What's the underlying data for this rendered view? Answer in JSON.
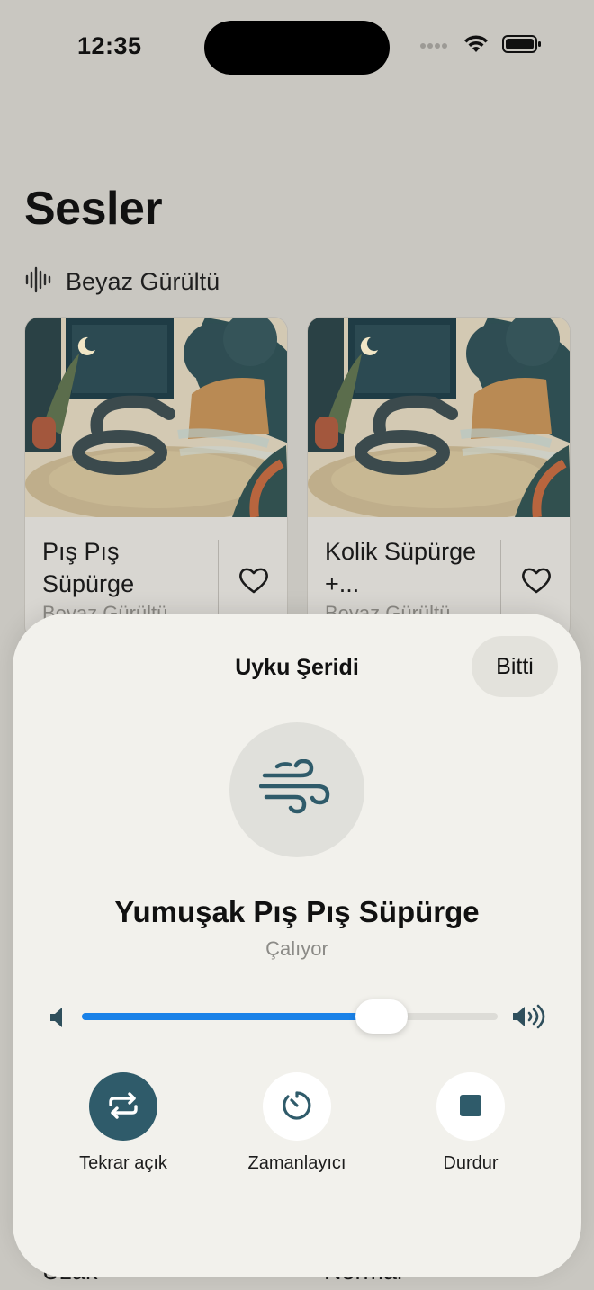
{
  "status_bar": {
    "time": "12:35"
  },
  "page": {
    "title": "Sesler"
  },
  "section": {
    "label": "Beyaz Gürültü",
    "icon": "waveform-icon"
  },
  "cards": [
    {
      "title": "Pış Pış Süpürge",
      "subtitle": "Beyaz Gürültü",
      "favorite_icon": "heart-icon"
    },
    {
      "title": "Kolik Süpürge +...",
      "subtitle": "Beyaz Gürültü",
      "favorite_icon": "heart-icon"
    }
  ],
  "bottom_cards": [
    {
      "title": "Uzak"
    },
    {
      "title": "Normal"
    }
  ],
  "sheet": {
    "title": "Uyku Şeridi",
    "done_label": "Bitti",
    "sound_icon": "wind-icon",
    "track_name": "Yumuşak Pış Pış Süpürge",
    "status": "Çalıyor",
    "volume": 0.72,
    "controls": [
      {
        "label": "Tekrar açık",
        "icon": "repeat-icon",
        "active": true
      },
      {
        "label": "Zamanlayıcı",
        "icon": "timer-icon",
        "active": false
      },
      {
        "label": "Durdur",
        "icon": "stop-icon",
        "active": false
      }
    ]
  },
  "colors": {
    "accent": "#1a82e8",
    "primary_dark": "#2f5b6a",
    "sheet_bg": "#f2f1ec",
    "page_bg": "#c9c7c1"
  }
}
